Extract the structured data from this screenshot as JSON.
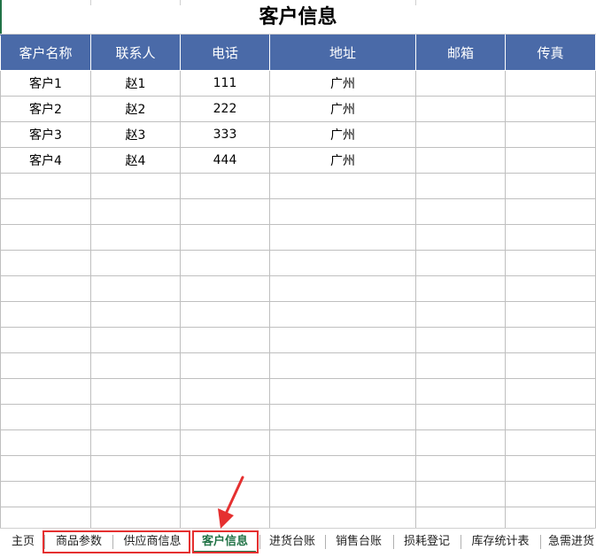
{
  "sheet": {
    "title": "客户信息",
    "columns": [
      "客户名称",
      "联系人",
      "电话",
      "地址",
      "邮箱",
      "传真"
    ],
    "rows": [
      [
        "客户1",
        "赵1",
        "111",
        "广州",
        "",
        ""
      ],
      [
        "客户2",
        "赵2",
        "222",
        "广州",
        "",
        ""
      ],
      [
        "客户3",
        "赵3",
        "333",
        "广州",
        "",
        ""
      ],
      [
        "客户4",
        "赵4",
        "444",
        "广州",
        "",
        ""
      ]
    ],
    "empty_row_count": 14
  },
  "tabs": [
    "主页",
    "商品参数",
    "供应商信息",
    "客户信息",
    "进货台账",
    "销售台账",
    "损耗登记",
    "库存统计表",
    "急需进货"
  ],
  "active_tab": "客户信息",
  "highlighted_tabs": [
    "商品参数",
    "供应商信息",
    "客户信息"
  ],
  "colors": {
    "header_bg": "#4a6aa8",
    "header_text": "#ffffff",
    "active_tab": "#217346",
    "highlight": "#e53030",
    "grid": "#bfbfbf"
  }
}
